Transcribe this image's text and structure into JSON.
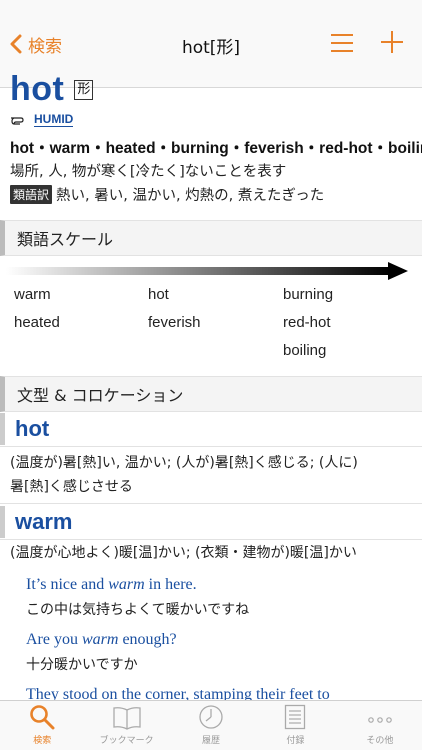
{
  "nav": {
    "back_label": "検索",
    "title": "hot[形]"
  },
  "entry": {
    "headword": "hot",
    "pos": "形",
    "xref": "HUMID",
    "synonyms_line": "hot・warm・heated・burning・feverish・red-hot・boiling",
    "definition": "場所, 人, 物が寒く[冷たく]ないことを表す",
    "translation_badge": "類語訳",
    "translation": "熱い, 暑い, 温かい, 灼熱の, 煮えたぎった"
  },
  "scale": {
    "header": "類語スケール",
    "words": [
      "warm",
      "heated",
      "hot",
      "feverish",
      "burning",
      "red-hot",
      "boiling"
    ]
  },
  "collocation": {
    "header": "文型 & コロケーション",
    "entries": [
      {
        "word": "hot",
        "def_line1": "(温度が)暑[熱]い, 温かい; (人が)暑[熱]く感じる; (人に)",
        "def_line2": "暑[熱]く感じさせる"
      },
      {
        "word": "warm",
        "def_line1": "(温度が心地よく)暖[温]かい; (衣類・建物が)暖[温]かい",
        "examples": [
          {
            "en_pre": "It’s nice and ",
            "en_em": "warm",
            "en_post": " in here.",
            "ja": "この中は気持ちよくて暖かいですね"
          },
          {
            "en_pre": "Are you ",
            "en_em": "warm",
            "en_post": " enough?",
            "ja": "十分暖かいですか"
          },
          {
            "en_pre": "They stood on the corner, stamping their feet to",
            "en_em": "",
            "en_post": "",
            "ja": ""
          }
        ]
      }
    ]
  },
  "tabs": [
    {
      "label": "検索",
      "icon": "search-icon"
    },
    {
      "label": "ブックマーク",
      "icon": "book-icon"
    },
    {
      "label": "履歴",
      "icon": "clock-icon"
    },
    {
      "label": "付録",
      "icon": "document-icon"
    },
    {
      "label": "その他",
      "icon": "more-icon"
    }
  ],
  "colors": {
    "accent": "#e8822a",
    "link": "#1a4fa0"
  }
}
